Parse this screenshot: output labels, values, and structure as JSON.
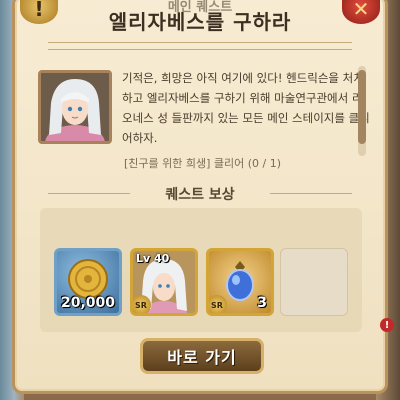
{
  "header": {
    "subtitle": "메인 퀘스트",
    "title": "엘리자베스를 구하라",
    "info_icon": "exclamation-icon",
    "close_icon": "x-icon"
  },
  "quest": {
    "description": "기적은, 희망은 아직 여기에 있다! 헨드릭슨을 처치하고 엘리자베스를 구하기 위해 마술연구관에서 리오네스 성 들판까지 있는 모든 메인 스테이지를 클리어하자.",
    "objective": "[친구를 위한 희생] 클리어 (0 / 1)"
  },
  "rewards": {
    "heading": "퀘스트 보상",
    "items": [
      {
        "type": "gold",
        "quantity": "20,000"
      },
      {
        "type": "hero",
        "level": "Lv 40",
        "rank": "SR"
      },
      {
        "type": "awakening-stone",
        "quantity": "3",
        "rank": "SR"
      },
      {
        "type": "empty"
      }
    ]
  },
  "action": {
    "go_label": "바로 가기"
  },
  "colors": {
    "panel": "#f4e8cc",
    "button": "#6e5029",
    "button_border": "#d7b06a",
    "close": "#c0392b"
  }
}
